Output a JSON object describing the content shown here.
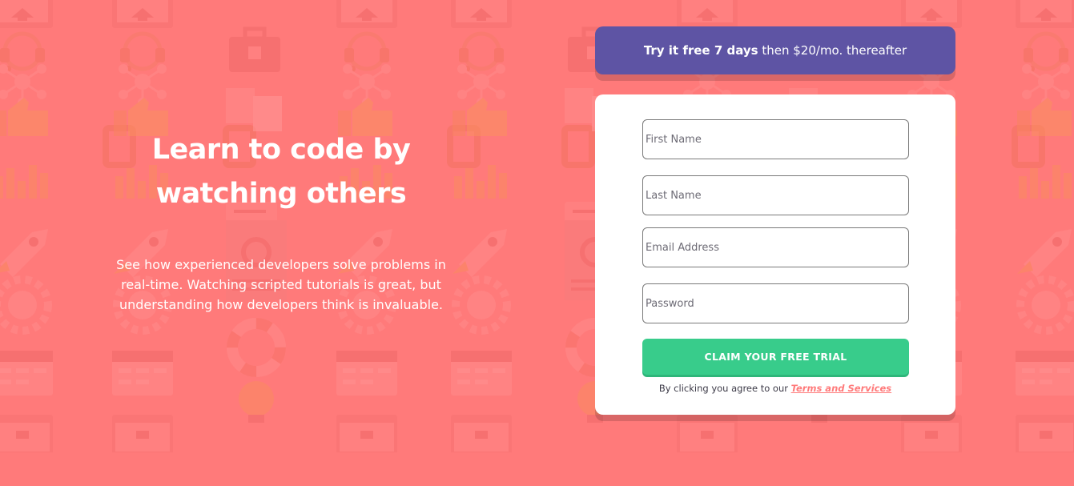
{
  "colors": {
    "background": "#ff7a7a",
    "banner": "#5e54a4",
    "cta": "#38cc8b",
    "link": "#ff7a7a",
    "card": "#ffffff"
  },
  "hero": {
    "title_line1": "Learn to code by",
    "title_line2": "watching others",
    "description": "See how experienced developers solve problems in real-time. Watching scripted tutorials is great, but understanding how developers think is invaluable."
  },
  "banner": {
    "bold_text": "Try it free 7 days",
    "regular_text": " then $20/mo. thereafter"
  },
  "form": {
    "first_name_placeholder": "First Name",
    "last_name_placeholder": "Last Name",
    "email_placeholder": "Email Address",
    "password_placeholder": "Password",
    "submit_label": "CLAIM YOUR FREE TRIAL",
    "terms_prefix": "By clicking you agree to our ",
    "terms_link": "Terms and Services"
  },
  "background_icons": [
    "computer-icon",
    "headset-icon",
    "toolbox-icon",
    "network-icon",
    "thumbs-up-icon",
    "chart-icon",
    "chat-icon",
    "rocket-icon",
    "globe-gear-icon",
    "lifebuoy-icon",
    "calendar-icon",
    "bulb-icon",
    "browser-window-icon"
  ]
}
